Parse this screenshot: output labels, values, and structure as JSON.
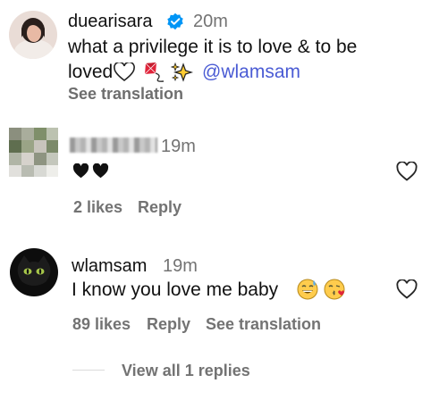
{
  "caption": {
    "username": "duearisara",
    "time": "20m",
    "text_line1": "what a privilege it is to love & to be",
    "text_line2": "loved",
    "mention": "@wlamsam",
    "see_translation": "See translation"
  },
  "comments": [
    {
      "username_hidden": true,
      "time": "19m",
      "text": "",
      "likes": "2 likes",
      "reply": "Reply"
    },
    {
      "username": "wlamsam",
      "time": "19m",
      "text": "I know you love me baby",
      "likes": "89 likes",
      "reply": "Reply",
      "see_translation": "See translation"
    }
  ],
  "view_replies": "View all 1 replies",
  "icons": {
    "verified": "verified-badge-icon",
    "like": "heart-outline-icon",
    "emojis_caption": [
      "white-heart-emoji",
      "kite-emoji",
      "sparkles-emoji"
    ],
    "emojis_comment1": [
      "black-heart-emoji",
      "black-heart-emoji"
    ],
    "emojis_comment2": [
      "sweat-smile-emoji",
      "kissing-heart-emoji"
    ]
  },
  "colors": {
    "verified": "#0095f6",
    "mention": "#4a5bd4",
    "secondary": "#737373"
  }
}
